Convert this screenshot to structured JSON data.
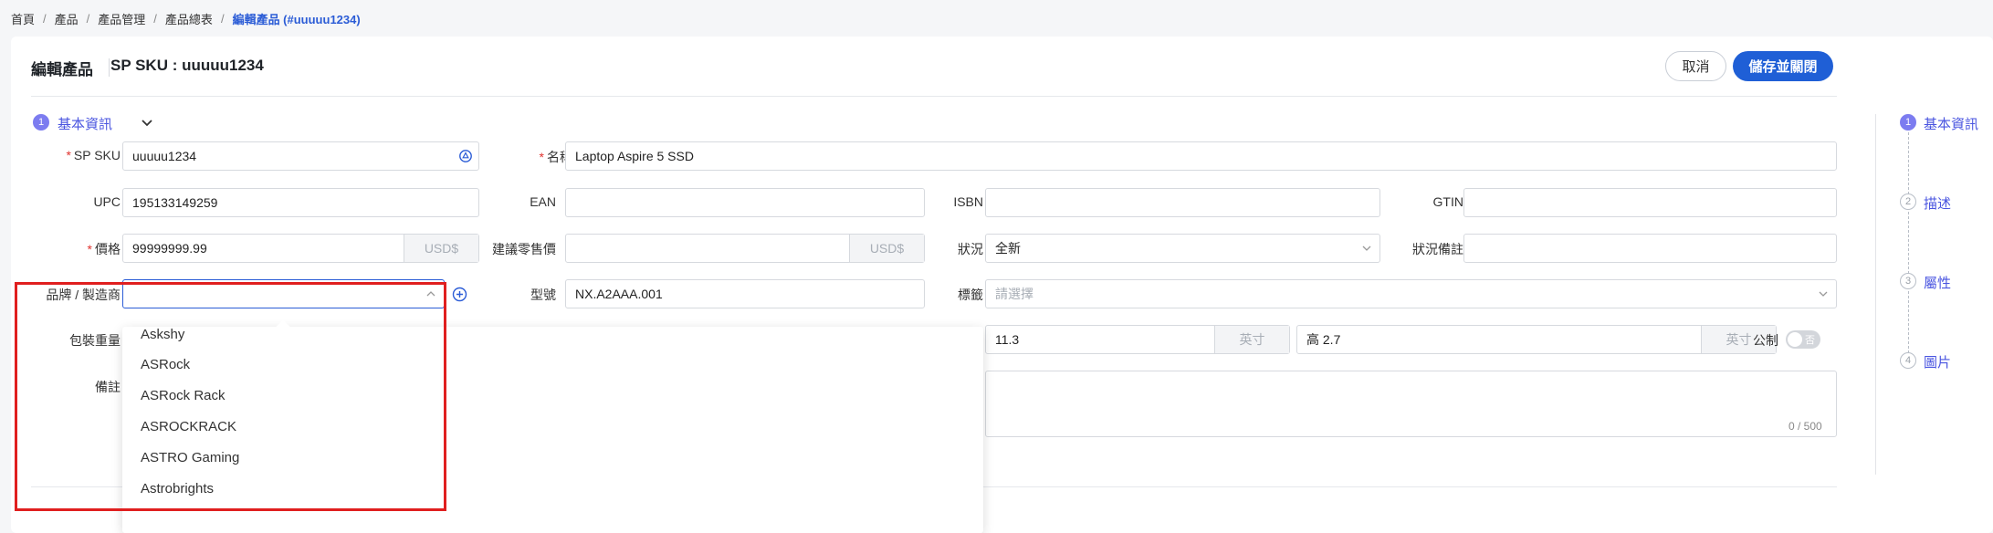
{
  "breadcrumb": {
    "items": [
      "首頁",
      "產品",
      "產品管理",
      "產品總表"
    ],
    "current": "編輯產品 (#uuuuu1234)",
    "separator": "/"
  },
  "header": {
    "title": "編輯產品",
    "sku": "SP SKU : uuuuu1234",
    "cancel_label": "取消",
    "save_label": "儲存並關閉"
  },
  "section": {
    "number": "1",
    "label": "基本資訊"
  },
  "form": {
    "sp_sku": {
      "label": "SP SKU",
      "value": "uuuuu1234"
    },
    "name": {
      "label": "名稱",
      "value": "Laptop Aspire 5 SSD"
    },
    "upc": {
      "label": "UPC",
      "value": "195133149259"
    },
    "ean": {
      "label": "EAN",
      "value": ""
    },
    "isbn": {
      "label": "ISBN",
      "value": ""
    },
    "gtin": {
      "label": "GTIN",
      "value": ""
    },
    "price": {
      "label": "價格",
      "value": "99999999.99",
      "unit": "USD$"
    },
    "msrp": {
      "label": "建議零售價",
      "value": "",
      "unit": "USD$"
    },
    "condition": {
      "label": "狀況",
      "value": "全新"
    },
    "condition_note": {
      "label": "狀況備註",
      "value": ""
    },
    "brand": {
      "label": "品牌 / 製造商",
      "value": ""
    },
    "model": {
      "label": "型號",
      "value": "NX.A2AAA.001"
    },
    "tags": {
      "label": "標籤",
      "placeholder": "請選擇"
    },
    "package_weight": {
      "label": "包裝重量"
    },
    "dim_width": {
      "value": "11.3",
      "unit": "英寸"
    },
    "dim_height": {
      "value": "高  2.7",
      "unit": "英寸"
    },
    "metric": {
      "label": "公制",
      "toggle_text": "否"
    },
    "notes": {
      "label": "備註",
      "counter": "0 / 500"
    }
  },
  "brand_dropdown": {
    "options": [
      "Askshy",
      "ASRock",
      "ASRock Rack",
      "ASROCKRACK",
      "ASTRO Gaming",
      "Astrobrights"
    ]
  },
  "steps": [
    {
      "number": "1",
      "label": "基本資訊",
      "active": true
    },
    {
      "number": "2",
      "label": "描述",
      "active": false
    },
    {
      "number": "3",
      "label": "屬性",
      "active": false
    },
    {
      "number": "4",
      "label": "圖片",
      "active": false
    }
  ],
  "colors": {
    "accent": "#1f5fd6",
    "step_active": "#7c7cf0",
    "required": "#e0332f",
    "highlight": "#e01f1f"
  }
}
